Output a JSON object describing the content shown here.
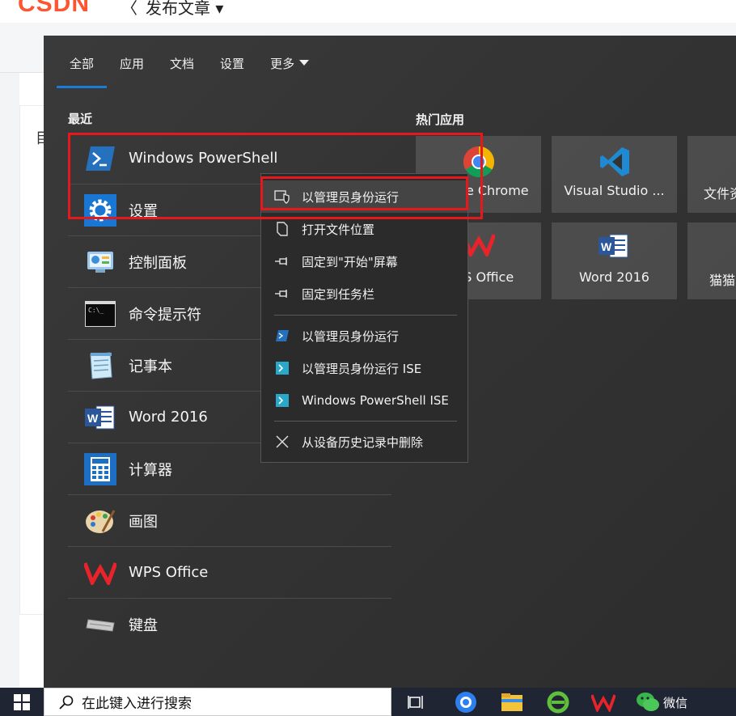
{
  "background": {
    "logo": "CSDN",
    "back_arrow": "〈",
    "page_title": "发布文章 ▾",
    "doc_char": "目"
  },
  "tabs": [
    {
      "label": "全部",
      "active": true
    },
    {
      "label": "应用"
    },
    {
      "label": "文档"
    },
    {
      "label": "设置"
    },
    {
      "label": "更多"
    }
  ],
  "recent": {
    "title": "最近",
    "items": [
      {
        "label": "Windows PowerShell",
        "icon": "powershell-icon"
      },
      {
        "label": "设置",
        "icon": "settings-gear-icon"
      },
      {
        "label": "控制面板",
        "icon": "control-panel-icon"
      },
      {
        "label": "命令提示符",
        "icon": "command-prompt-icon"
      },
      {
        "label": "记事本",
        "icon": "notepad-icon"
      },
      {
        "label": "Word 2016",
        "icon": "word-icon"
      },
      {
        "label": "计算器",
        "icon": "calculator-icon"
      },
      {
        "label": "画图",
        "icon": "paint-icon"
      },
      {
        "label": "WPS Office",
        "icon": "wps-icon"
      },
      {
        "label": "键盘",
        "icon": "keyboard-icon"
      }
    ]
  },
  "hot_apps": {
    "title": "热门应用",
    "tiles": [
      {
        "label": "Google Chrome",
        "icon": "chrome-icon"
      },
      {
        "label": "Visual Studio ...",
        "icon": "vscode-icon"
      },
      {
        "label": "文件资",
        "icon": "file-explorer-icon"
      },
      {
        "label": "WPS Office",
        "icon": "wps-icon"
      },
      {
        "label": "Word 2016",
        "icon": "word-icon"
      },
      {
        "label": "猫猫",
        "icon": "app-icon"
      }
    ]
  },
  "context_menu": {
    "items": [
      {
        "label": "以管理员身份运行",
        "icon": "shield-admin-icon",
        "highlighted": true
      },
      {
        "label": "打开文件位置",
        "icon": "file-location-icon"
      },
      {
        "label": "固定到\"开始\"屏幕",
        "icon": "pin-icon"
      },
      {
        "label": "固定到任务栏",
        "icon": "pin-icon"
      },
      {
        "label": "以管理员身份运行",
        "icon": "powershell-icon"
      },
      {
        "label": "以管理员身份运行 ISE",
        "icon": "powershell-ise-icon"
      },
      {
        "label": "Windows PowerShell ISE",
        "icon": "powershell-ise-icon"
      },
      {
        "label": "从设备历史记录中删除",
        "icon": "close-icon"
      }
    ]
  },
  "taskbar": {
    "search_placeholder": "在此键入进行搜索",
    "wechat_label": "微信"
  },
  "colors": {
    "accent": "#1b7ad8",
    "highlight_box": "#e5191c",
    "taskbar": "#1f2532",
    "menu_bg": "#333333"
  }
}
